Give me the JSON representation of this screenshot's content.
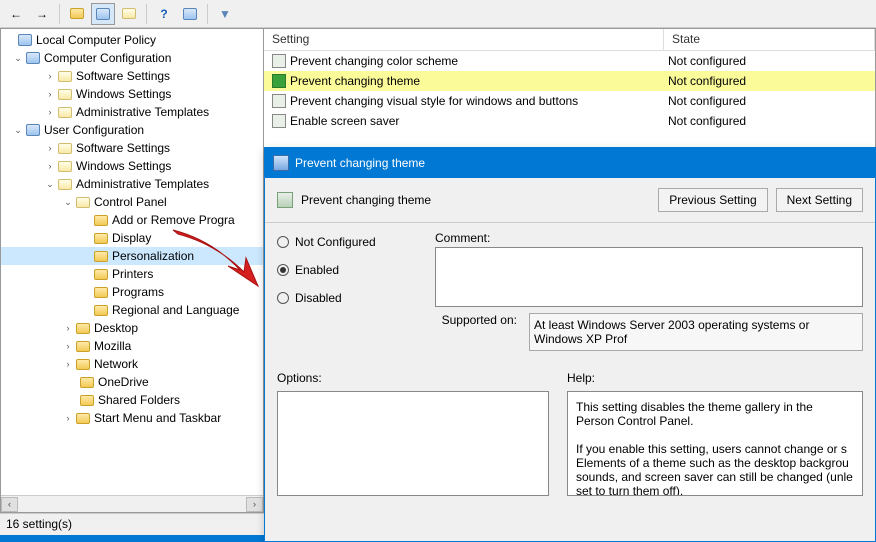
{
  "toolbar": {},
  "tree": {
    "root": "Local Computer Policy",
    "compConf": "Computer Configuration",
    "compConfItems": [
      "Software Settings",
      "Windows Settings",
      "Administrative Templates"
    ],
    "userConf": "User Configuration",
    "userConfItems": [
      "Software Settings",
      "Windows Settings",
      "Administrative Templates"
    ],
    "ctrlPanel": "Control Panel",
    "ctrlItems": [
      "Add or Remove Progra",
      "Display",
      "Personalization",
      "Printers",
      "Programs",
      "Regional and Language"
    ],
    "otherItems": [
      "Desktop",
      "Mozilla",
      "Network",
      "OneDrive",
      "Shared Folders",
      "Start Menu and Taskbar"
    ]
  },
  "list": {
    "header": {
      "setting": "Setting",
      "state": "State"
    },
    "rows": [
      {
        "label": "Prevent changing color scheme",
        "state": "Not configured",
        "hl": false
      },
      {
        "label": "Prevent changing theme",
        "state": "Not configured",
        "hl": true
      },
      {
        "label": "Prevent changing visual style for windows and buttons",
        "state": "Not configured",
        "hl": false
      },
      {
        "label": "Enable screen saver",
        "state": "Not configured",
        "hl": false
      }
    ]
  },
  "dialog": {
    "title": "Prevent changing theme",
    "headerTitle": "Prevent changing theme",
    "btnPrev": "Previous Setting",
    "btnNext": "Next Setting",
    "radios": {
      "notConf": "Not Configured",
      "enabled": "Enabled",
      "disabled": "Disabled"
    },
    "commentLabel": "Comment:",
    "supportedLabel": "Supported on:",
    "supportedText": "At least Windows Server 2003 operating systems or Windows XP Prof",
    "optionsLabel": "Options:",
    "helpLabel": "Help:",
    "helpText": "This setting disables the theme gallery in the Person Control Panel.\n\nIf you enable this setting, users cannot change or s Elements of a theme such as the desktop backgrou sounds, and screen saver can still be changed (unle set to turn them off)."
  },
  "status": {
    "text": "16 setting(s)"
  }
}
